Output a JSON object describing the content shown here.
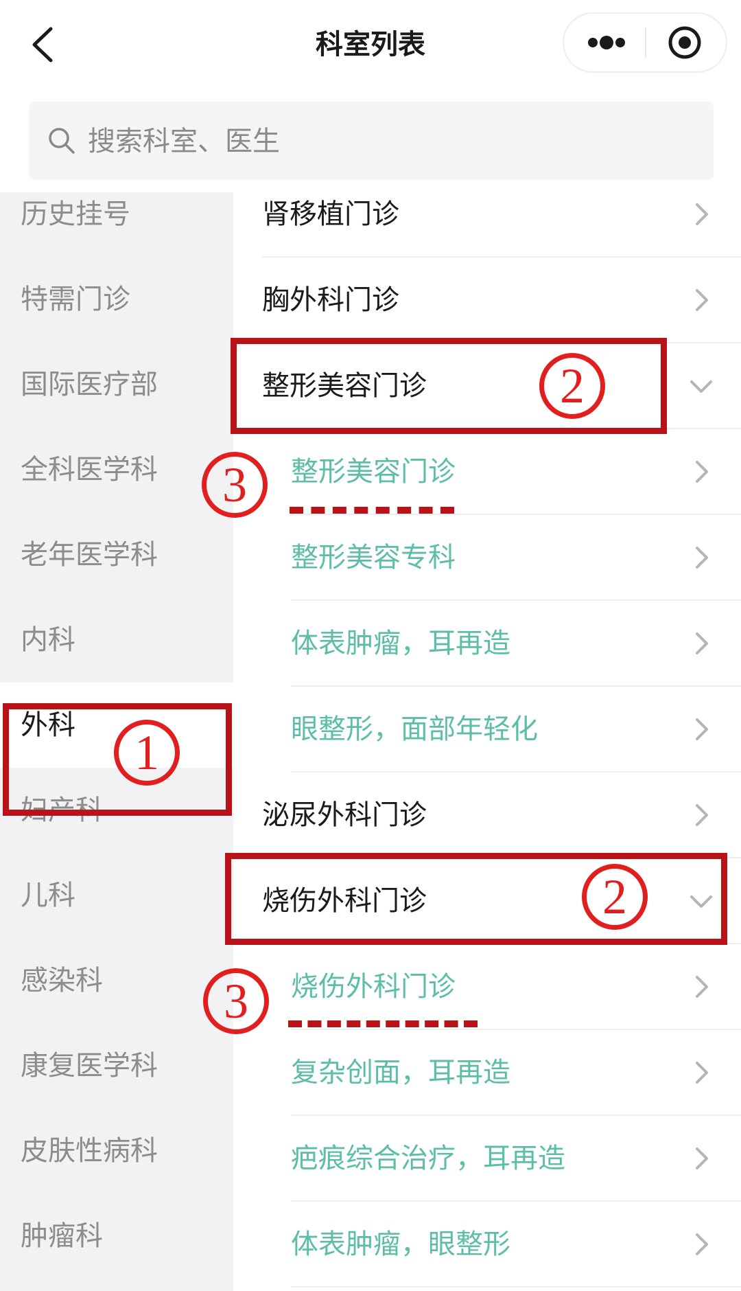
{
  "nav": {
    "title": "科室列表"
  },
  "search": {
    "placeholder": "搜索科室、医生"
  },
  "sidebar": {
    "items": [
      {
        "label": "历史挂号"
      },
      {
        "label": "特需门诊"
      },
      {
        "label": "国际医疗部"
      },
      {
        "label": "全科医学科"
      },
      {
        "label": "老年医学科"
      },
      {
        "label": "内科"
      },
      {
        "label": "外科",
        "active": true
      },
      {
        "label": "妇产科"
      },
      {
        "label": "儿科"
      },
      {
        "label": "感染科"
      },
      {
        "label": "康复医学科"
      },
      {
        "label": "皮肤性病科"
      },
      {
        "label": "肿瘤科"
      }
    ]
  },
  "departments": [
    {
      "label": "肾移植门诊",
      "level": "parent",
      "chevron": "right"
    },
    {
      "label": "胸外科门诊",
      "level": "parent",
      "chevron": "right"
    },
    {
      "label": "整形美容门诊",
      "level": "parent",
      "chevron": "down"
    },
    {
      "label": "整形美容门诊",
      "level": "child",
      "chevron": "right"
    },
    {
      "label": "整形美容专科",
      "level": "child",
      "chevron": "right"
    },
    {
      "label": "体表肿瘤，耳再造",
      "level": "child",
      "chevron": "right"
    },
    {
      "label": "眼整形，面部年轻化",
      "level": "child",
      "chevron": "right"
    },
    {
      "label": "泌尿外科门诊",
      "level": "parent",
      "chevron": "right"
    },
    {
      "label": "烧伤外科门诊",
      "level": "parent",
      "chevron": "down"
    },
    {
      "label": "烧伤外科门诊",
      "level": "child",
      "chevron": "right"
    },
    {
      "label": "复杂创面，耳再造",
      "level": "child",
      "chevron": "right"
    },
    {
      "label": "疤痕综合治疗，耳再造",
      "level": "child",
      "chevron": "right"
    },
    {
      "label": "体表肿瘤，眼整形",
      "level": "child",
      "chevron": "right"
    }
  ],
  "annotations": {
    "one": "1",
    "two": "2",
    "three": "3"
  },
  "colors": {
    "child_text": "#5dbea7",
    "annotation_red": "#b9131a",
    "sidebar_bg": "#f2f2f4"
  }
}
